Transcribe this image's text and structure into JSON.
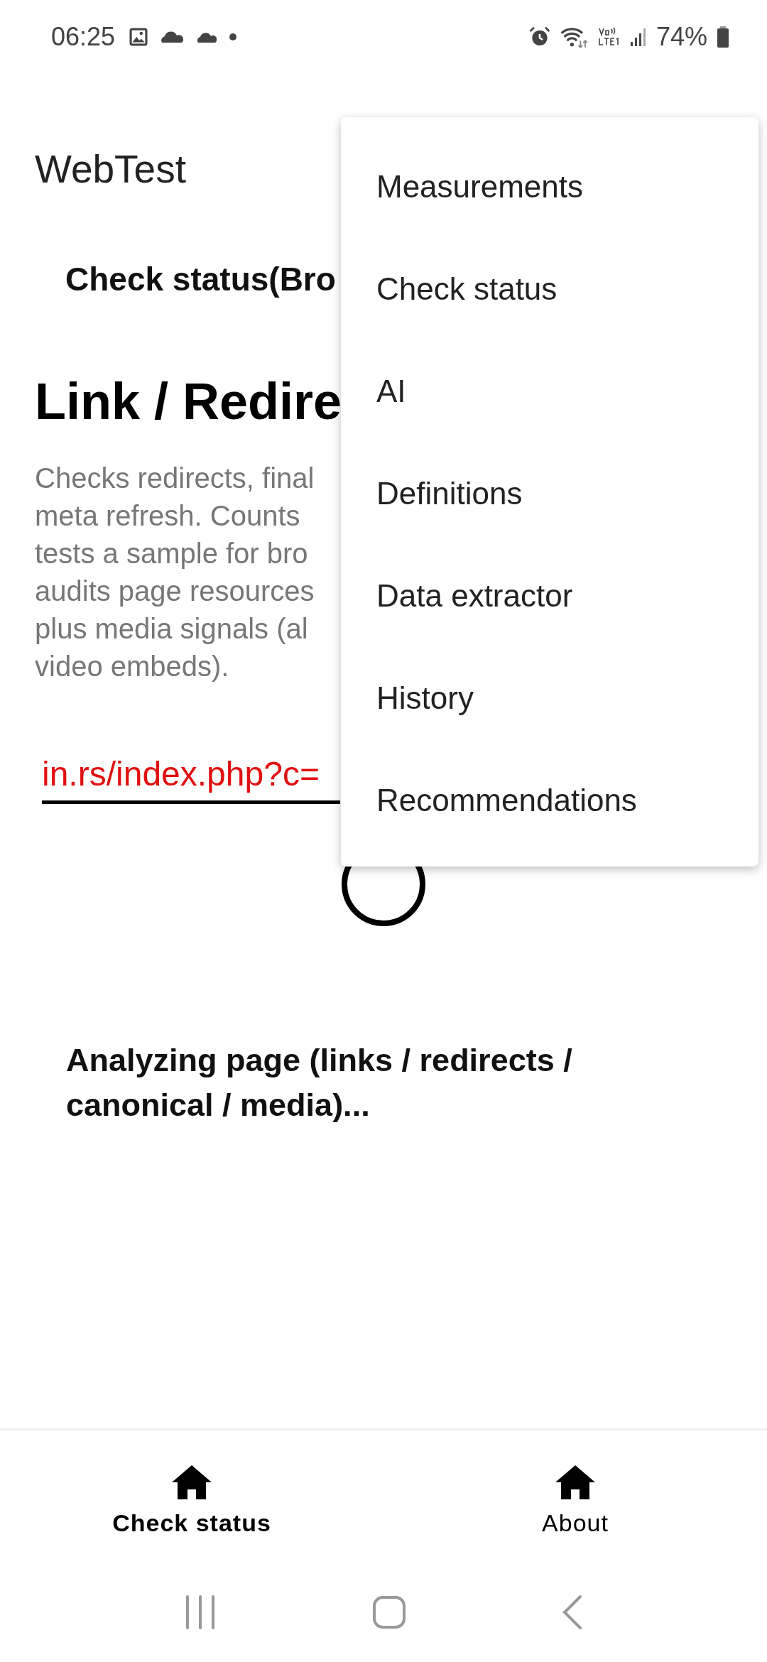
{
  "status_bar": {
    "time": "06:25",
    "battery": "74%"
  },
  "app_bar": {
    "title": "WebTest"
  },
  "page": {
    "subtitle": "Check status(Bro",
    "heading": "Link / Redire",
    "description_lines": [
      "Checks redirects, final",
      "meta refresh. Counts",
      "tests a sample for bro",
      "audits page resources",
      "plus media signals (al",
      "video embeds)."
    ],
    "url_field": {
      "value": "in.rs/index.php?c="
    },
    "progress_text": "Analyzing page (links / redirects / canonical / media)..."
  },
  "menu": {
    "items": [
      {
        "label": "Measurements"
      },
      {
        "label": "Check status"
      },
      {
        "label": "AI"
      },
      {
        "label": "Definitions"
      },
      {
        "label": "Data extractor"
      },
      {
        "label": "History"
      },
      {
        "label": "Recommendations"
      }
    ]
  },
  "bottom_nav": [
    {
      "label": "Check status",
      "selected": true
    },
    {
      "label": "About",
      "selected": false
    }
  ]
}
